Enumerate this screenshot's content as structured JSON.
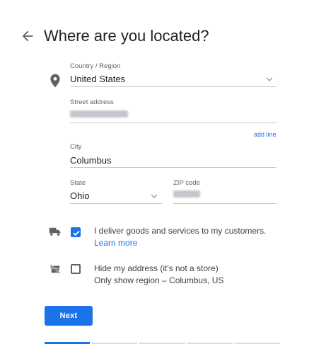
{
  "page": {
    "title": "Where are you located?"
  },
  "form": {
    "country": {
      "label": "Country / Region",
      "value": "United States"
    },
    "street": {
      "label": "Street address",
      "value": ""
    },
    "add_line_label": "add line",
    "city": {
      "label": "City",
      "value": "Columbus"
    },
    "state": {
      "label": "State",
      "value": "Ohio"
    },
    "zip": {
      "label": "ZIP code",
      "value": ""
    }
  },
  "options": {
    "deliver": {
      "checked": true,
      "text": "I deliver goods and services to my customers.",
      "link": "Learn more"
    },
    "hide_address": {
      "checked": false,
      "text": "Hide my address (it's not a store)",
      "subtext": "Only show region – Columbus, US"
    }
  },
  "actions": {
    "next_label": "Next"
  },
  "progress": {
    "total_steps": 5,
    "current_step": 1
  },
  "colors": {
    "accent": "#1a73e8",
    "text": "#202124",
    "muted": "#5f6368",
    "divider": "#dadce0"
  },
  "icons": [
    "back-arrow-icon",
    "location-pin-icon",
    "chevron-down-icon",
    "delivery-truck-icon",
    "store-off-icon",
    "checkmark-icon"
  ]
}
